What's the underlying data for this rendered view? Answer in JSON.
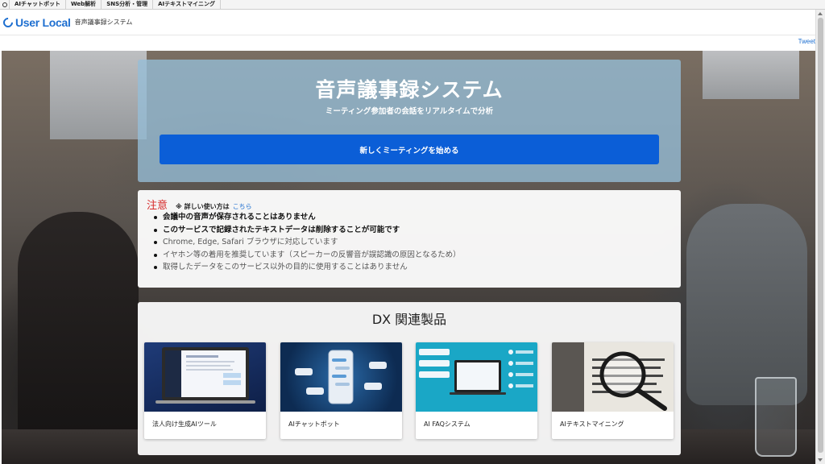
{
  "topbar": {
    "links": [
      "AIチャットボット",
      "Web解析",
      "SNS分析・管理",
      "AIテキストマイニング"
    ]
  },
  "header": {
    "logo_text": "User Local",
    "app_name": "音声議事録システム"
  },
  "tweet_label": "Tweet",
  "hero": {
    "title": "音声議事録システム",
    "subtitle": "ミーティング参加者の会話をリアルタイムで分析",
    "start_button": "新しくミーティングを始める"
  },
  "notice": {
    "title": "注意",
    "hint": "※ 詳しい使い方は",
    "hint_link": "こちら",
    "items": [
      "会議中の音声が保存されることはありません",
      "このサービスで記録されたテキストデータは削除することが可能です",
      "Chrome, Edge, Safari ブラウザに対応しています",
      "イヤホン等の着用を推奨しています（スピーカーの反響音が誤認識の原因となるため）",
      "取得したデータをこのサービス以外の目的に使用することはありません"
    ]
  },
  "dx": {
    "title": "DX 関連製品",
    "products": [
      {
        "label": "法人向け生成AIツール"
      },
      {
        "label": "AIチャットボット"
      },
      {
        "label": "AI FAQシステム"
      },
      {
        "label": "AIテキストマイニング"
      }
    ]
  },
  "colors": {
    "brand_blue": "#1e6fd0",
    "primary_button": "#0b5ed7",
    "notice_red": "#d62828"
  }
}
